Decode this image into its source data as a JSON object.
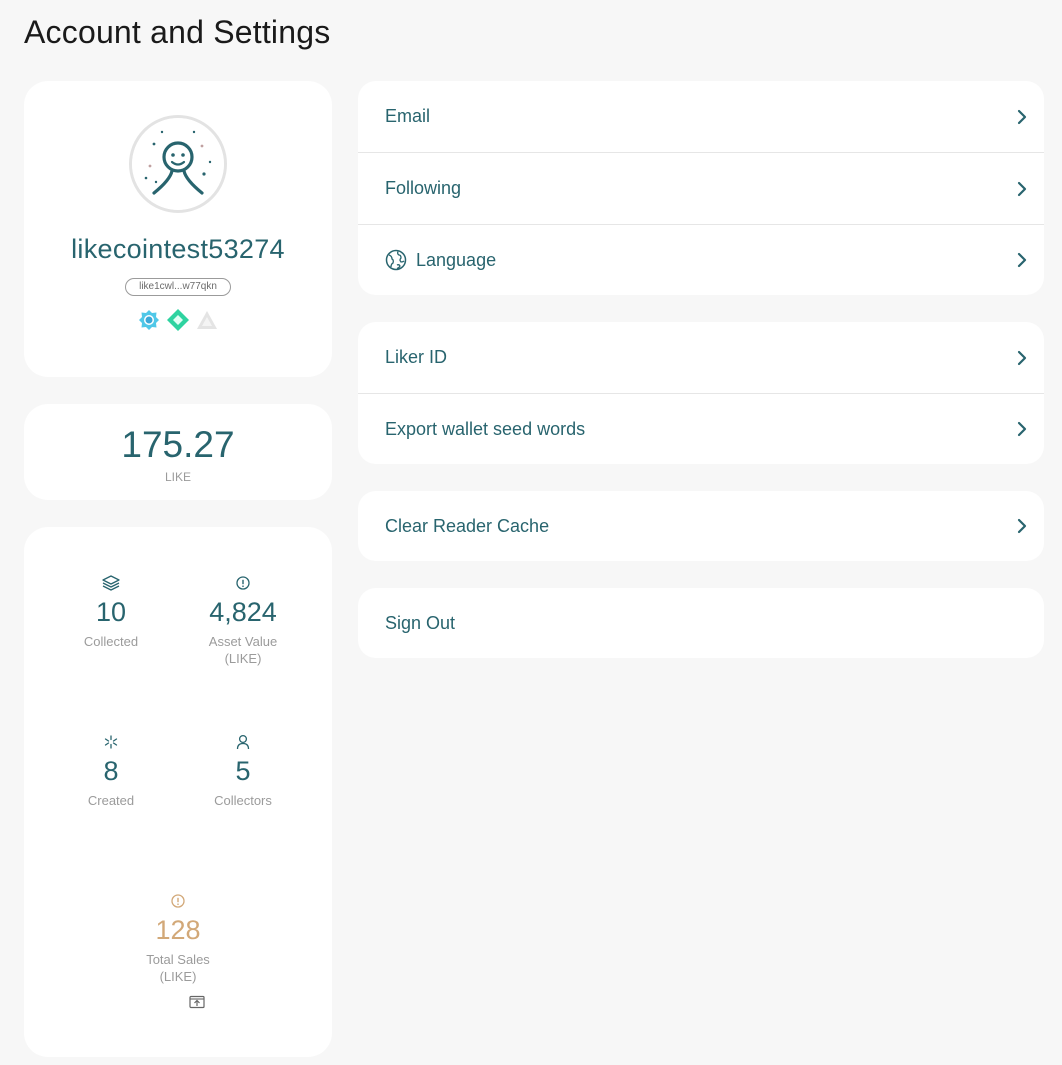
{
  "page": {
    "title": "Account and Settings"
  },
  "profile": {
    "username": "likecointest53274",
    "address": "like1cwl...w77qkn",
    "badges": [
      "civic-badge-icon",
      "creator-badge-icon",
      "collector-badge-icon"
    ]
  },
  "balance": {
    "value": "175.27",
    "unit": "LIKE"
  },
  "stats": {
    "collected": {
      "value": "10",
      "label": "Collected",
      "icon": "layers-icon"
    },
    "asset_value": {
      "value": "4,824",
      "label": "Asset Value\n(LIKE)",
      "icon": "info-icon"
    },
    "created": {
      "value": "8",
      "label": "Created",
      "icon": "sparkle-icon"
    },
    "collectors": {
      "value": "5",
      "label": "Collectors",
      "icon": "person-icon"
    },
    "total_sales": {
      "value": "128",
      "label": "Total Sales\n(LIKE)",
      "icon": "info-icon"
    }
  },
  "settings": {
    "group1": [
      {
        "label": "Email"
      },
      {
        "label": "Following"
      },
      {
        "label": "Language",
        "icon": "globe-icon"
      }
    ],
    "group2": [
      {
        "label": "Liker ID"
      },
      {
        "label": "Export wallet seed words"
      }
    ],
    "group3": [
      {
        "label": "Clear Reader Cache"
      }
    ],
    "group4": [
      {
        "label": "Sign Out"
      }
    ]
  },
  "colors": {
    "primary": "#28646e",
    "gold": "#d2a878",
    "muted": "#9b9b9b",
    "background": "#f7f7f7"
  }
}
